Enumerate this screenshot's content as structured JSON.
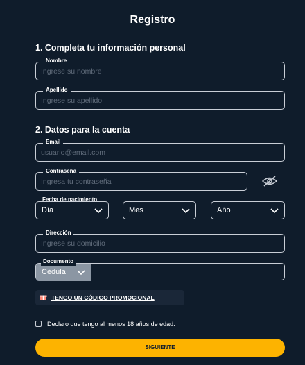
{
  "form": {
    "title": "Registro",
    "section1": "1. Completa tu información personal",
    "section2": "2. Datos para la cuenta",
    "nombre": {
      "label": "Nombre",
      "placeholder": "Ingrese su nombre"
    },
    "apellido": {
      "label": "Apellido",
      "placeholder": "Ingrese su apellido"
    },
    "email": {
      "label": "Email",
      "placeholder": "usuario@email.com"
    },
    "password": {
      "label": "Contraseña",
      "placeholder": "Ingresa tu contraseña"
    },
    "birthdate": {
      "label": "Fecha de nacimiento",
      "day": "Día",
      "month": "Mes",
      "year": "Año"
    },
    "address": {
      "label": "Dirección",
      "placeholder": "Ingrese su domicilio"
    },
    "document": {
      "label": "Documento",
      "type": "Cédula",
      "value": ""
    },
    "promo": "TENGO UN CÓDIGO PROMOCIONAL",
    "age_check": "Declaro que tengo al menos 18 años de edad.",
    "submit": "SIGUIENTE"
  },
  "icons": {
    "password_toggle": "eye-off-icon",
    "promo": "gift-icon",
    "select": "chevron-down-icon"
  },
  "colors": {
    "background": "#0f1c2b",
    "border": "#c9ced6",
    "placeholder": "#5f6b7a",
    "accent": "#fdb300",
    "doc_select": "#8b96a3",
    "promo_bg": "#1a2738"
  }
}
